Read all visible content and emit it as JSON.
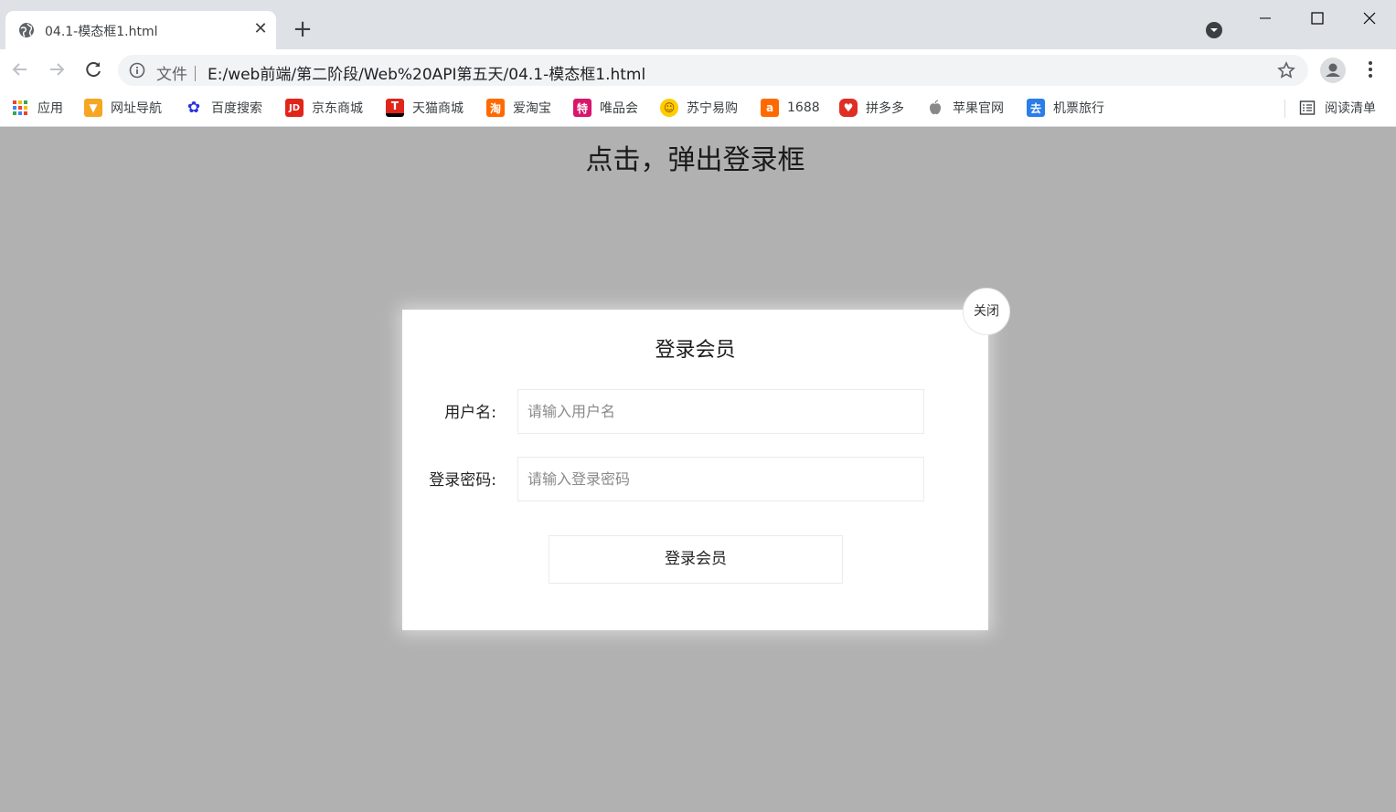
{
  "browser": {
    "tab": {
      "title": "04.1-模态框1.html",
      "favicon": "globe-icon",
      "close": "✕"
    },
    "new_tab": "+",
    "address": {
      "scheme": "文件｜",
      "url": "E:/web前端/第二阶段/Web%20API第五天/04.1-模态框1.html"
    },
    "bookmarks": [
      {
        "label": "应用",
        "icon": "apps-grid-icon",
        "color": "#4285f4"
      },
      {
        "label": "网址导航",
        "icon": "arrow-nav-icon",
        "color": "#f5a623"
      },
      {
        "label": "百度搜索",
        "icon": "baidu-paw-icon",
        "color": "#2932e1"
      },
      {
        "label": "京东商城",
        "icon": "jd-icon",
        "color": "#e1251b",
        "glyph": "JD"
      },
      {
        "label": "天猫商城",
        "icon": "tmall-icon",
        "color": "#000000",
        "glyph": "T"
      },
      {
        "label": "爱淘宝",
        "icon": "taobao-icon",
        "color": "#ff6a00",
        "glyph": "淘"
      },
      {
        "label": "唯品会",
        "icon": "vip-icon",
        "color": "#d8166b",
        "glyph": "特"
      },
      {
        "label": "苏宁易购",
        "icon": "suning-lion-icon",
        "color": "#ffcc00",
        "glyph": "☺"
      },
      {
        "label": "1688",
        "icon": "alibaba-icon",
        "color": "#ff6a00",
        "glyph": "a"
      },
      {
        "label": "拼多多",
        "icon": "pinduoduo-icon",
        "color": "#e02e24",
        "glyph": "♥"
      },
      {
        "label": "苹果官网",
        "icon": "apple-icon",
        "color": "#888888"
      },
      {
        "label": "机票旅行",
        "icon": "travel-icon",
        "color": "#2b7de9",
        "glyph": "去"
      }
    ],
    "reading_list": "阅读清单"
  },
  "page": {
    "heading": "点击，弹出登录框",
    "modal": {
      "close_label": "关闭",
      "title": "登录会员",
      "username_label": "用户名:",
      "username_placeholder": "请输入用户名",
      "password_label": "登录密码:",
      "password_placeholder": "请输入登录密码",
      "submit_label": "登录会员"
    }
  }
}
